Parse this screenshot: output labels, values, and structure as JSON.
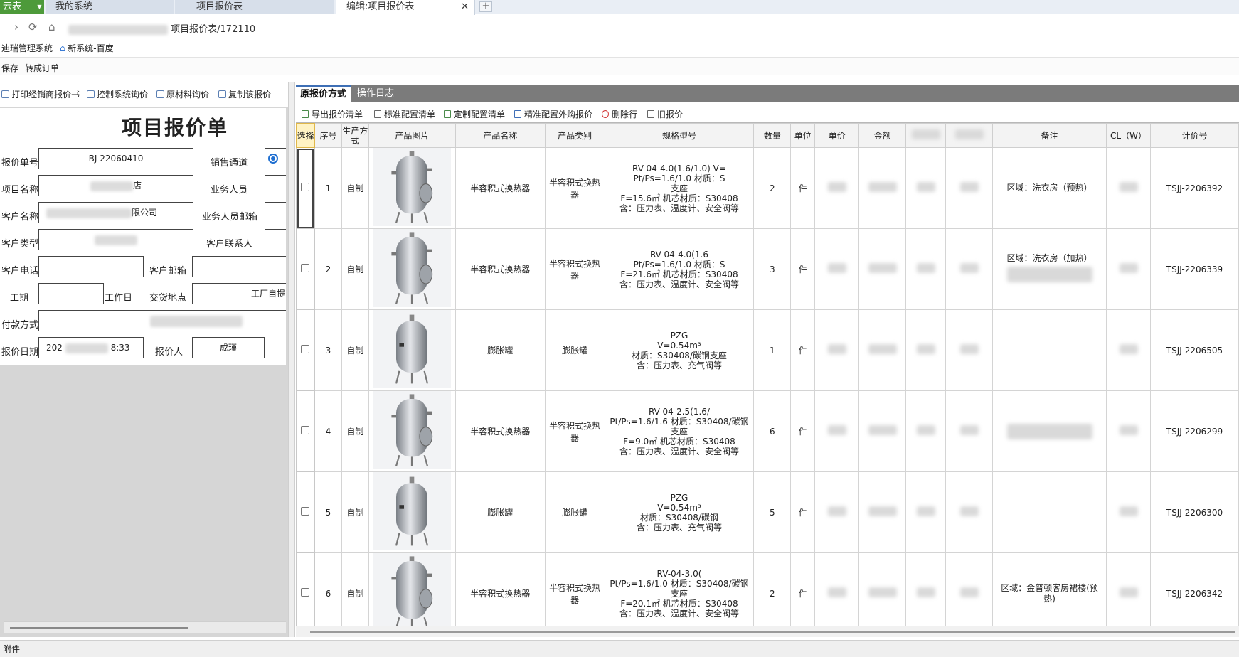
{
  "browser": {
    "brand_label": "云表",
    "tabs": [
      {
        "label": "我的系统"
      },
      {
        "label": "项目报价表"
      },
      {
        "label": "编辑:项目报价表",
        "close": "✕"
      }
    ],
    "new_tab": "+",
    "address_suffix": "项目报价表/172110",
    "bookmarks": [
      {
        "label": "迪瑞管理系统"
      },
      {
        "label": "新系统-百度"
      }
    ]
  },
  "menu": {
    "save": "保存",
    "to_order": "转成订单"
  },
  "left_toolbar": [
    {
      "label": "打印经销商报价书",
      "icon": "print-icon"
    },
    {
      "label": "控制系统询价",
      "icon": "control-icon"
    },
    {
      "label": "原材料询价",
      "icon": "material-icon"
    },
    {
      "label": "复制该报价",
      "icon": "copy-icon"
    }
  ],
  "form": {
    "title": "项目报价单",
    "quote_no_label": "报价单号",
    "quote_no": "BJ-22060410",
    "channel_label": "销售通道",
    "project_name_label": "项目名称",
    "project_name_suffix": "店",
    "salesperson_label": "业务人员",
    "customer_name_label": "客户名称",
    "customer_name_suffix": "限公司",
    "sales_email_label": "业务人员邮箱",
    "customer_type_label": "客户类型",
    "customer_contact_label": "客户联系人",
    "customer_phone_label": "客户电话",
    "customer_email_label": "客户邮箱",
    "period_label": "工期",
    "workday_label": "工作日",
    "delivery_label": "交货地点",
    "delivery_value": "工厂自提",
    "payment_label": "付款方式",
    "quote_date_label": "报价日期",
    "quote_date_prefix": "202",
    "quote_date_suffix": "8:33",
    "quoter_label": "报价人",
    "quoter": "成瑾"
  },
  "right_tabs": {
    "active": "原报价方式",
    "other": "操作日志"
  },
  "right_toolbar": [
    {
      "label": "导出报价清单",
      "icon": "export-icon"
    },
    {
      "label": "标准配置清单",
      "icon": "standard-config-icon"
    },
    {
      "label": "定制配置清单",
      "icon": "custom-config-icon"
    },
    {
      "label": "精准配置外购报价",
      "icon": "binoculars-icon"
    },
    {
      "label": "删除行",
      "icon": "delete-icon"
    },
    {
      "label": "旧报价",
      "icon": "old-quote-icon"
    }
  ],
  "table": {
    "headers": [
      "选择",
      "序号",
      "生产方式",
      "产品图片",
      "产品名称",
      "产品类别",
      "规格型号",
      "数量",
      "单位",
      "单价",
      "金额",
      "",
      "",
      "备注",
      "CL（W）",
      "计价号"
    ],
    "rows": [
      {
        "no": "1",
        "mode": "自制",
        "name": "半容积式换热器",
        "category": "半容积式换热器",
        "image": "heat-exchanger",
        "spec": [
          "RV-04-4.0(1.6/1.0) V=",
          "Pt/Ps=1.6/1.0 材质：S",
          "支座",
          "F=15.6㎡ 机芯材质：S30408",
          "含：压力表、温度计、安全阀等"
        ],
        "qty": "2",
        "unit": "件",
        "note": "区域：洗衣房（预热）",
        "code": "TSJJ-2206392"
      },
      {
        "no": "2",
        "mode": "自制",
        "name": "半容积式换热器",
        "category": "半容积式换热器",
        "image": "heat-exchanger",
        "spec": [
          "RV-04-4.0(1.6",
          "Pt/Ps=1.6/1.0 材质：S",
          "F=21.6㎡ 机芯材质：S30408",
          "含：压力表、温度计、安全阀等"
        ],
        "qty": "3",
        "unit": "件",
        "note": "区域：洗衣房（加热）",
        "code": "TSJJ-2206339"
      },
      {
        "no": "3",
        "mode": "自制",
        "name": "膨胀罐",
        "category": "膨胀罐",
        "image": "expansion-tank",
        "spec": [
          "PZG",
          "V=0.54m³",
          "材质：S30408/碳钢支座",
          "含：压力表、充气阀等"
        ],
        "qty": "1",
        "unit": "件",
        "note": "",
        "code": "TSJJ-2206505"
      },
      {
        "no": "4",
        "mode": "自制",
        "name": "半容积式换热器",
        "category": "半容积式换热器",
        "image": "heat-exchanger",
        "spec": [
          "RV-04-2.5(1.6/",
          "Pt/Ps=1.6/1.6 材质：S30408/碳钢支座",
          "F=9.0㎡ 机芯材质：S30408",
          "含：压力表、温度计、安全阀等"
        ],
        "qty": "6",
        "unit": "件",
        "note": "",
        "code": "TSJJ-2206299"
      },
      {
        "no": "5",
        "mode": "自制",
        "name": "膨胀罐",
        "category": "膨胀罐",
        "image": "expansion-tank",
        "spec": [
          "PZG",
          "V=0.54m³",
          "材质：S30408/碳钢",
          "含：压力表、充气阀等"
        ],
        "qty": "5",
        "unit": "件",
        "note": "",
        "code": "TSJJ-2206300"
      },
      {
        "no": "6",
        "mode": "自制",
        "name": "半容积式换热器",
        "category": "半容积式换热器",
        "image": "heat-exchanger",
        "spec": [
          "RV-04-3.0(",
          "Pt/Ps=1.6/1.0 材质：S30408/碳钢支座",
          "F=20.1㎡ 机芯材质：S30408",
          "含：压力表、温度计、安全阀等"
        ],
        "qty": "2",
        "unit": "件",
        "note": "区域：金普顿客房裙楼(预热)",
        "code": "TSJJ-2206342"
      }
    ]
  },
  "status_bar": {
    "label": "附件"
  }
}
